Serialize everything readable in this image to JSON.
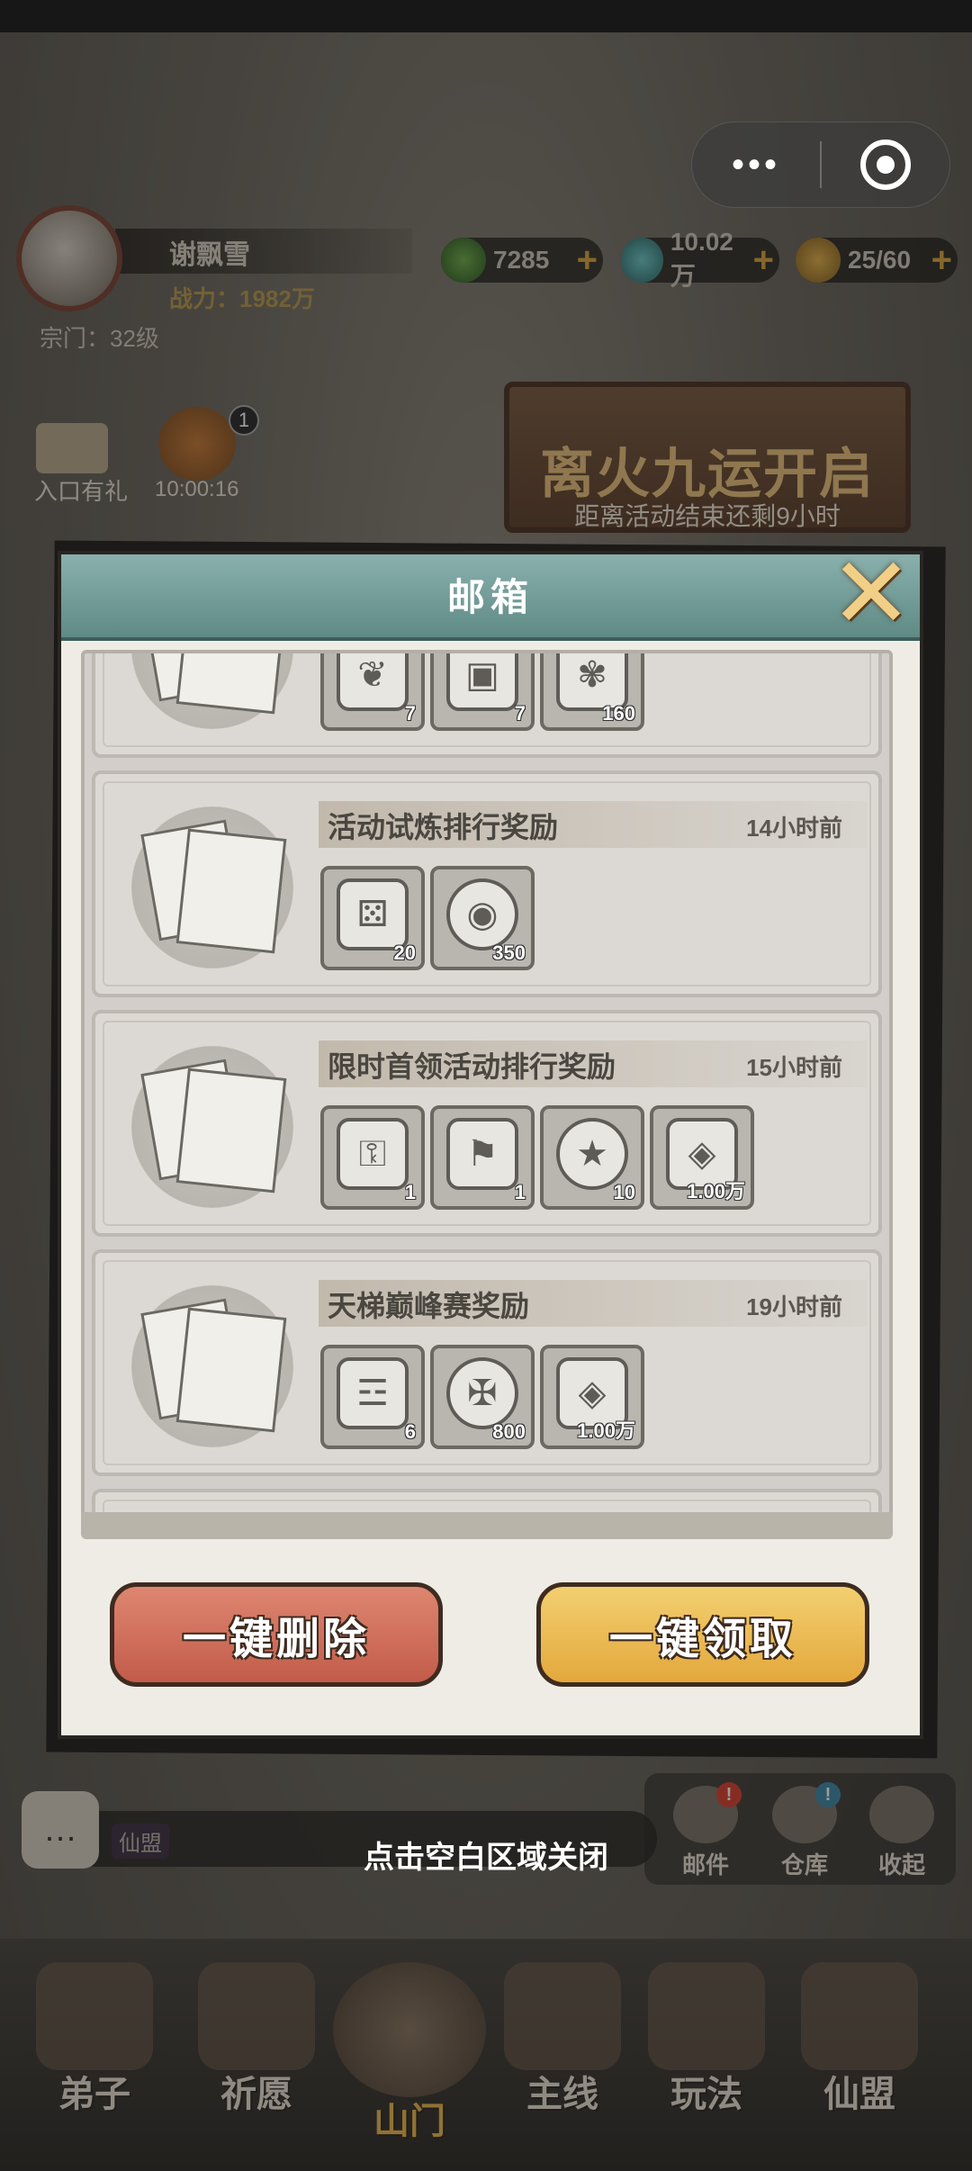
{
  "player": {
    "name": "谢飘雪",
    "power": "战力：1982万",
    "sect_level": "宗门：32级"
  },
  "resources": [
    {
      "icon": "jade-icon",
      "value": "7285"
    },
    {
      "icon": "gem-icon",
      "value": "10.02万"
    },
    {
      "icon": "gourd-icon",
      "value": "25/60"
    }
  ],
  "side_items": {
    "gift_label": "入口有礼",
    "timer": "10:00:16",
    "bag_badge": "1"
  },
  "event_banner": {
    "title": "离火九运开启",
    "subtitle": "距离活动结束还剩9小时"
  },
  "mailbox": {
    "title": "邮箱",
    "mails": [
      {
        "title": "",
        "time": "",
        "items": [
          {
            "icon": "scroll-icon",
            "qty": "7"
          },
          {
            "icon": "chest-icon",
            "qty": "7"
          },
          {
            "icon": "ore-icon",
            "qty": "160"
          }
        ]
      },
      {
        "title": "活动试炼排行奖励",
        "time": "14小时前",
        "items": [
          {
            "icon": "dice-icon",
            "qty": "20"
          },
          {
            "icon": "coin-icon",
            "qty": "350"
          }
        ]
      },
      {
        "title": "限时首领活动排行奖励",
        "time": "15小时前",
        "items": [
          {
            "icon": "key-icon",
            "qty": "1"
          },
          {
            "icon": "banner-icon",
            "qty": "1"
          },
          {
            "icon": "star-coin-icon",
            "qty": "10"
          },
          {
            "icon": "stone-icon",
            "qty": "1.00万"
          }
        ]
      },
      {
        "title": "天梯巅峰赛奖励",
        "time": "19小时前",
        "items": [
          {
            "icon": "talisman-icon",
            "qty": "6"
          },
          {
            "icon": "sword-emblem-icon",
            "qty": "800"
          },
          {
            "icon": "stone-icon",
            "qty": "1.00万"
          }
        ]
      }
    ],
    "delete_all": "一键删除",
    "claim_all": "一键领取"
  },
  "tap_to_close": "点击空白区域关闭",
  "chat": {
    "channel": "仙盟"
  },
  "shortcuts": [
    {
      "label": "邮件",
      "badge": "!"
    },
    {
      "label": "仓库",
      "badge": "!"
    },
    {
      "label": "收起",
      "badge": ""
    }
  ],
  "nav": [
    {
      "label": "弟子"
    },
    {
      "label": "祈愿"
    },
    {
      "label": "山门"
    },
    {
      "label": "主线"
    },
    {
      "label": "玩法"
    },
    {
      "label": "仙盟"
    }
  ]
}
